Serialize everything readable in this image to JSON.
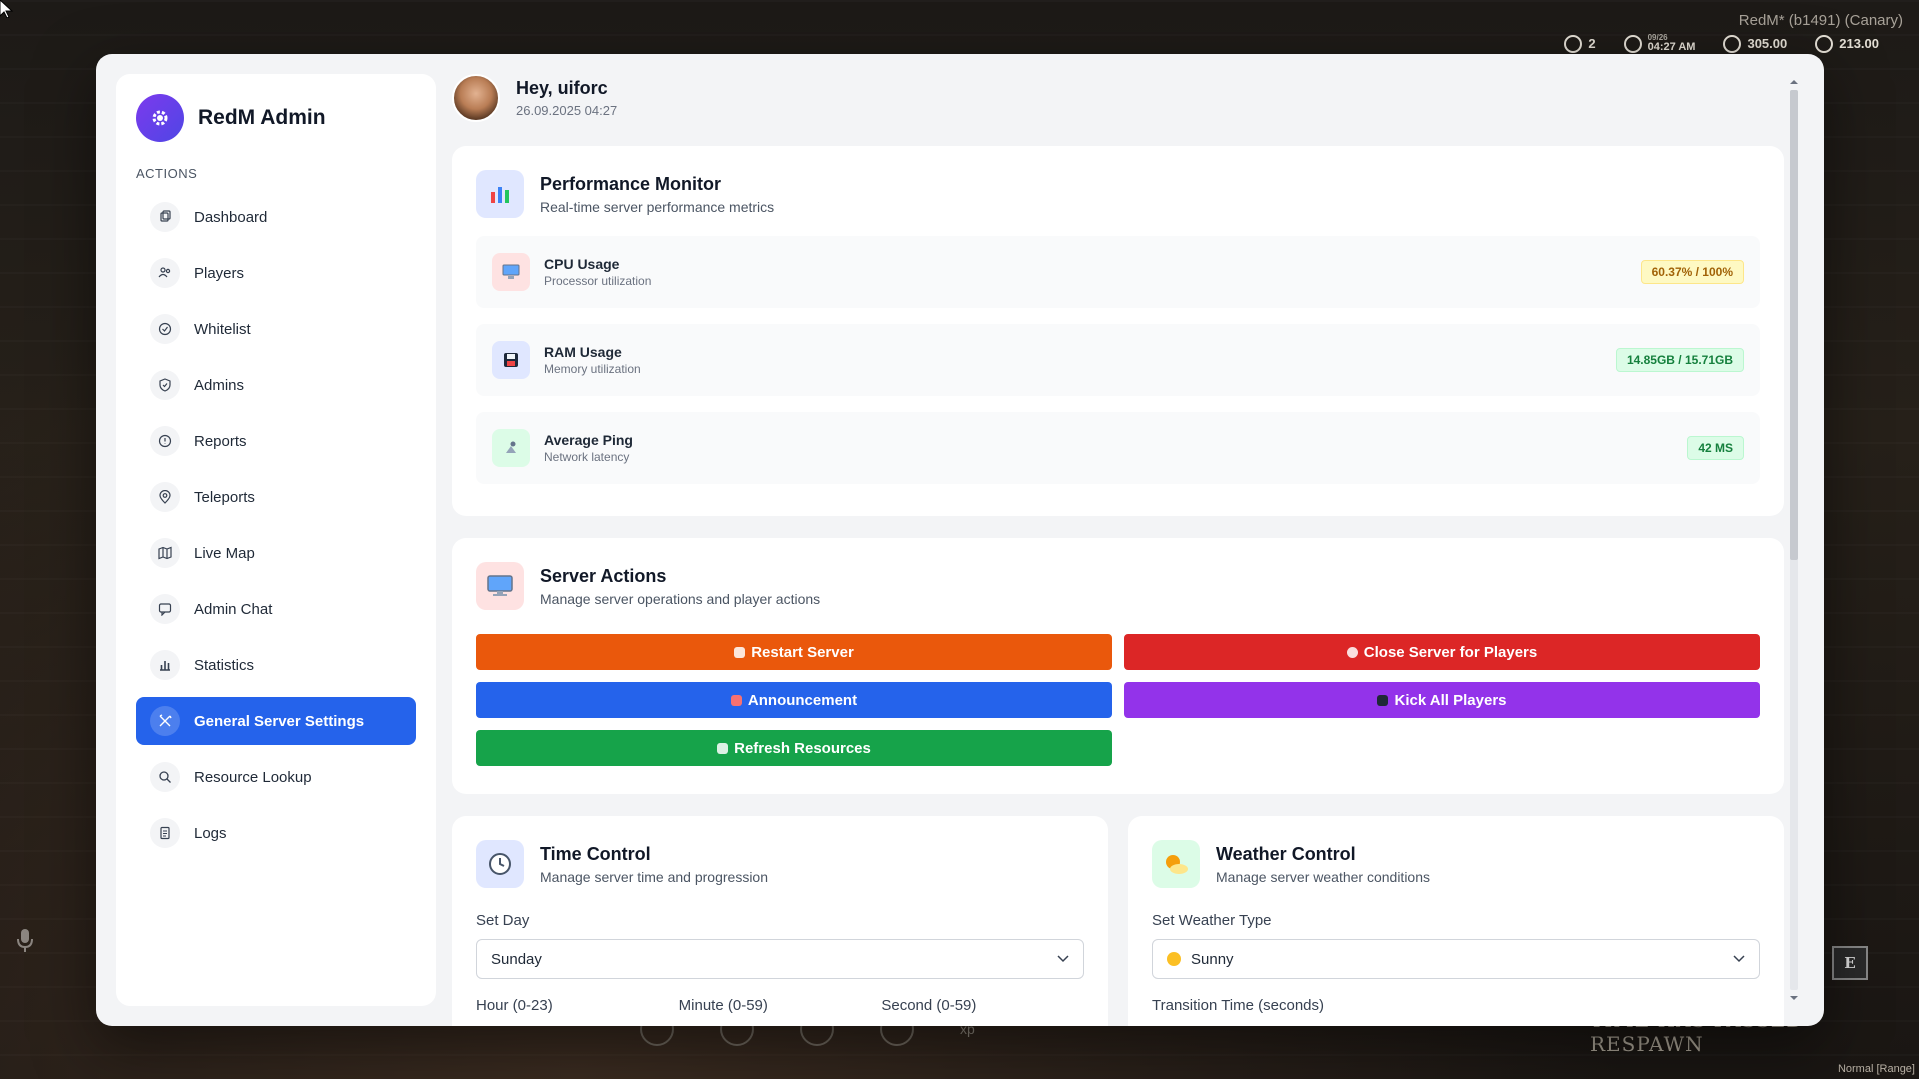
{
  "game": {
    "title": "RedM* (b1491) (Canary)",
    "hud": {
      "count": "2",
      "date": "09/26",
      "time": "04:27 AM",
      "money": "305.00",
      "gold": "213.00"
    },
    "key_hint": "E",
    "respawn_text": "TIME HAS PASSED RESPAWN",
    "mode_text": "Normal [Range]",
    "bottom_hud_xp": "xp"
  },
  "sidebar": {
    "brand": "RedM Admin",
    "section_label": "ACTIONS",
    "items": [
      {
        "label": "Dashboard",
        "icon": "copy-icon"
      },
      {
        "label": "Players",
        "icon": "users-icon"
      },
      {
        "label": "Whitelist",
        "icon": "check-circle-icon"
      },
      {
        "label": "Admins",
        "icon": "shield-icon"
      },
      {
        "label": "Reports",
        "icon": "alert-circle-icon"
      },
      {
        "label": "Teleports",
        "icon": "map-pin-icon"
      },
      {
        "label": "Live Map",
        "icon": "map-icon"
      },
      {
        "label": "Admin Chat",
        "icon": "message-icon"
      },
      {
        "label": "Statistics",
        "icon": "bar-chart-icon"
      },
      {
        "label": "General Server Settings",
        "icon": "tools-icon",
        "active": true
      },
      {
        "label": "Resource Lookup",
        "icon": "search-icon"
      },
      {
        "label": "Logs",
        "icon": "file-icon"
      }
    ]
  },
  "header": {
    "greeting": "Hey, uiforc",
    "datetime": "26.09.2025 04:27"
  },
  "performance": {
    "title": "Performance Monitor",
    "subtitle": "Real-time server performance metrics",
    "metrics": [
      {
        "name": "CPU Usage",
        "sub": "Processor utilization",
        "value": "60.37% / 100%",
        "icon": "monitor-icon"
      },
      {
        "name": "RAM Usage",
        "sub": "Memory utilization",
        "value": "14.85GB / 15.71GB",
        "icon": "floppy-icon"
      },
      {
        "name": "Average Ping",
        "sub": "Network latency",
        "value": "42 MS",
        "icon": "satellite-icon"
      }
    ]
  },
  "actions": {
    "title": "Server Actions",
    "subtitle": "Manage server operations and player actions",
    "buttons": {
      "restart": "Restart Server",
      "close": "Close Server for Players",
      "announce": "Announcement",
      "kick": "Kick All Players",
      "refresh": "Refresh Resources"
    }
  },
  "time_control": {
    "title": "Time Control",
    "subtitle": "Manage server time and progression",
    "day_label": "Set Day",
    "day_value": "Sunday",
    "hour_label": "Hour (0-23)",
    "minute_label": "Minute (0-59)",
    "second_label": "Second (0-59)"
  },
  "weather_control": {
    "title": "Weather Control",
    "subtitle": "Manage server weather conditions",
    "type_label": "Set Weather Type",
    "type_value": "Sunny",
    "transition_label": "Transition Time (seconds)"
  },
  "colors": {
    "accent": "#2563eb",
    "brand": "#6d28d9",
    "restart": "#ea580c",
    "close": "#dc2626",
    "announce": "#2563eb",
    "kick": "#9333ea",
    "refresh": "#16a34a"
  }
}
